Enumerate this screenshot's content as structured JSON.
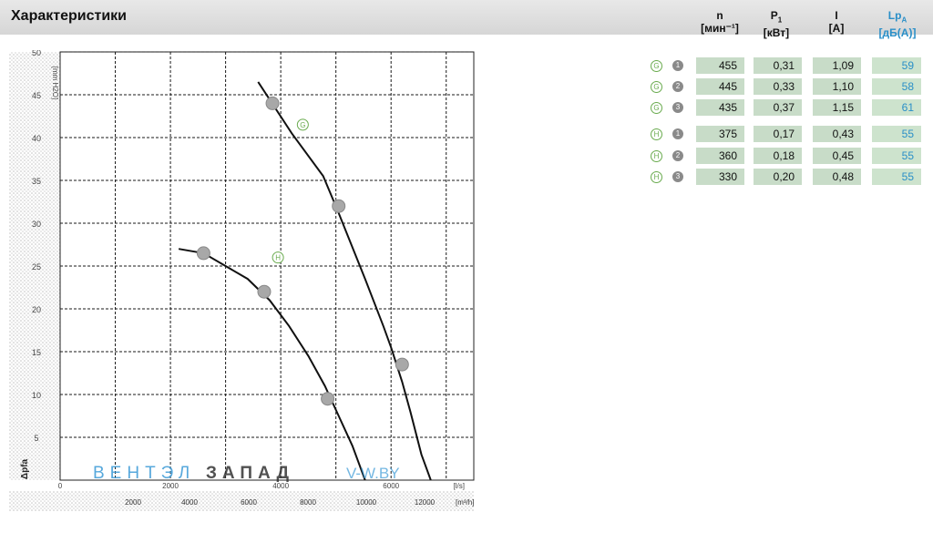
{
  "header": {
    "title": "Характеристики"
  },
  "columns": [
    {
      "key": "n",
      "name": "n",
      "unit": "[мин⁻¹]"
    },
    {
      "key": "p1",
      "name": "P",
      "sub": "1",
      "unit": "[кВт]"
    },
    {
      "key": "i",
      "name": "I",
      "unit": "[A]"
    },
    {
      "key": "lpa",
      "name": "Lp",
      "sub": "A",
      "unit": "[дБ(A)]"
    }
  ],
  "rows": [
    {
      "mode": "G",
      "point": "1",
      "n": "455",
      "p1": "0,31",
      "i": "1,09",
      "lpa": "59"
    },
    {
      "mode": "G",
      "point": "2",
      "n": "445",
      "p1": "0,33",
      "i": "1,10",
      "lpa": "58"
    },
    {
      "mode": "G",
      "point": "3",
      "n": "435",
      "p1": "0,37",
      "i": "1,15",
      "lpa": "61"
    },
    {
      "mode": "H",
      "point": "1",
      "n": "375",
      "p1": "0,17",
      "i": "0,43",
      "lpa": "55"
    },
    {
      "mode": "H",
      "point": "2",
      "n": "360",
      "p1": "0,18",
      "i": "0,45",
      "lpa": "55"
    },
    {
      "mode": "H",
      "point": "3",
      "n": "330",
      "p1": "0,20",
      "i": "0,48",
      "lpa": "55"
    }
  ],
  "colors": {
    "value_cell": "#c8dcc8",
    "lp_text": "#2a8fc8",
    "grid": "#1a1a1a",
    "curve": "#111111",
    "marker": "#a8a8a8",
    "badge_ring": "#6aab4f",
    "watermark_blue": "#3a9ad6",
    "watermark_dark": "#333333"
  },
  "watermark": {
    "part1": "ВЕНТЭЛ",
    "part2": "ЗАПАД",
    "part3": "V-W.BY"
  },
  "chart_data": {
    "type": "line",
    "xlabel": "[l/s]",
    "ylabel": "Δpfa",
    "xlim": [
      0,
      6000
    ],
    "ylim": [
      0,
      50
    ],
    "x_ticks": [
      0,
      2000,
      4000,
      6000
    ],
    "x_tick_labels": [
      "0",
      "2000",
      "4000",
      "6000"
    ],
    "x_unit_label": "[l/s]",
    "y_ticks": [
      5,
      10,
      15,
      20,
      25,
      30,
      35,
      40,
      45,
      50
    ],
    "y_tick_labels": [
      "5",
      "10",
      "15",
      "20",
      "25",
      "30",
      "35",
      "40",
      "45",
      "50"
    ],
    "y_unit_label": "[mm H2O]",
    "x2_ticks": [
      2000,
      4000,
      6000,
      8000,
      10000,
      12000
    ],
    "x2_tick_labels": [
      "2000",
      "4000",
      "6000",
      "8000",
      "10000",
      "12000"
    ],
    "x2_unit_label": "[m³/h]",
    "grid": true,
    "series": [
      {
        "name": "G",
        "points": [
          [
            3590,
            46.5
          ],
          [
            4200,
            40.5
          ],
          [
            4770,
            35.5
          ],
          [
            5030,
            31.5
          ],
          [
            5530,
            23.5
          ],
          [
            5860,
            18
          ],
          [
            6000,
            15.5
          ],
          [
            6200,
            11.5
          ],
          [
            6350,
            8
          ],
          [
            6550,
            3
          ],
          [
            6720,
            0
          ]
        ],
        "markers": [
          [
            3850,
            44
          ],
          [
            5050,
            32
          ],
          [
            6200,
            13.5
          ]
        ],
        "label_at": [
          4400,
          41.5
        ]
      },
      {
        "name": "H",
        "points": [
          [
            2150,
            27
          ],
          [
            2600,
            26.5
          ],
          [
            3000,
            25
          ],
          [
            3400,
            23.5
          ],
          [
            3800,
            21
          ],
          [
            4150,
            18
          ],
          [
            4500,
            14.5
          ],
          [
            4800,
            11
          ],
          [
            5050,
            7.5
          ],
          [
            5300,
            4
          ],
          [
            5530,
            0
          ]
        ],
        "markers": [
          [
            2600,
            26.5
          ],
          [
            3700,
            22
          ],
          [
            4850,
            9.5
          ]
        ],
        "label_at": [
          3950,
          26
        ]
      }
    ]
  }
}
